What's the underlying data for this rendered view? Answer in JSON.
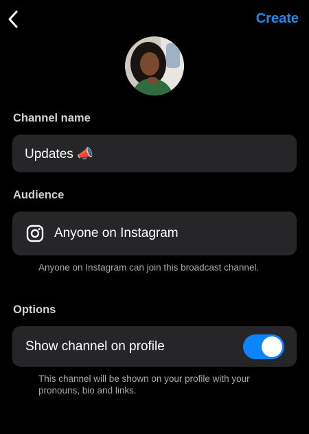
{
  "header": {
    "back_icon": "chevron-left-icon",
    "create_label": "Create"
  },
  "avatar": {
    "icon": "profile-photo"
  },
  "channel_name": {
    "section_label": "Channel name",
    "value": "Updates 📣"
  },
  "audience": {
    "section_label": "Audience",
    "icon": "instagram-icon",
    "selected_label": "Anyone on Instagram",
    "helper_text": "Anyone on Instagram can join this broadcast channel."
  },
  "options": {
    "section_label": "Options",
    "show_on_profile_label": "Show channel on profile",
    "show_on_profile_enabled": true,
    "helper_text": "This channel will be shown on your profile with your pronouns, bio and links."
  },
  "colors": {
    "accent": "#0a84ff",
    "create_text": "#1d8cf0",
    "card_bg": "#262628",
    "background": "#000000"
  }
}
